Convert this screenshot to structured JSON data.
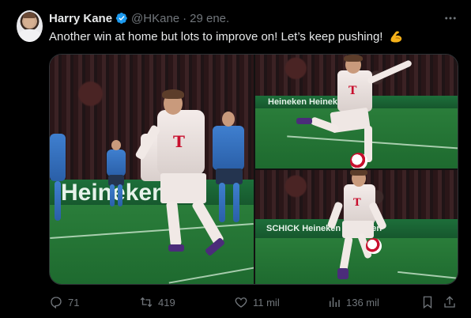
{
  "author": {
    "name": "Harry Kane",
    "handle": "@HKane",
    "separator": "·",
    "date": "29 ene."
  },
  "tweet": {
    "text": "Another win at home but lots to improve on! Let’s keep pushing!",
    "emoji": "flexed-biceps-emoji"
  },
  "media": {
    "photos": [
      {
        "label": "Heineken"
      },
      {
        "label": "Heineken Heineken"
      },
      {
        "label": "SCHICK Heineken Heineken"
      }
    ]
  },
  "actions": {
    "replies": "71",
    "reposts": "419",
    "likes": "11 mil",
    "views": "136 mil"
  },
  "icons": {
    "verified": "verified-badge-icon",
    "more": "more-options-icon",
    "reply": "reply-icon",
    "repost": "repost-icon",
    "like": "heart-icon",
    "views": "views-chart-icon",
    "bookmark": "bookmark-icon",
    "share": "share-icon"
  },
  "colors": {
    "background": "#000000",
    "text": "#e7e9ea",
    "muted": "#71767b",
    "verified": "#1d9bf0",
    "emoji": "#f6b21a"
  }
}
